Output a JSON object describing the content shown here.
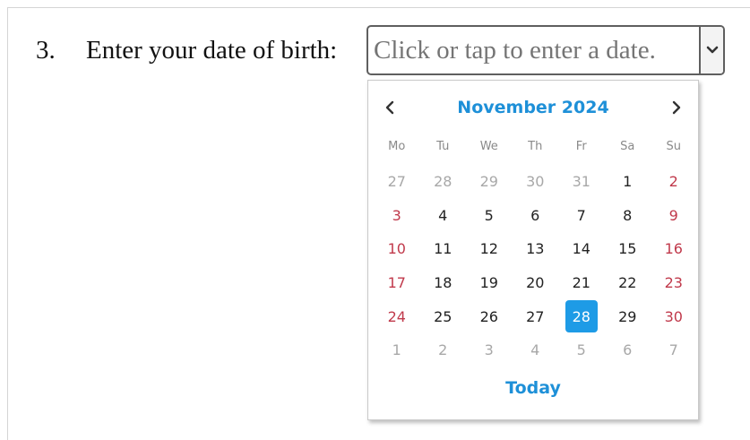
{
  "question": {
    "number": "3.",
    "text": "Enter your date of birth:"
  },
  "date_field": {
    "placeholder": "Click or tap to enter a date.",
    "dropdown_icon": "chevron-down-icon"
  },
  "calendar": {
    "month_label": "November 2024",
    "prev_icon": "chevron-left-icon",
    "next_icon": "chevron-right-icon",
    "weekdays": [
      "Mo",
      "Tu",
      "We",
      "Th",
      "Fr",
      "Sa",
      "Su"
    ],
    "weeks": [
      [
        {
          "d": "27",
          "out": true
        },
        {
          "d": "28",
          "out": true
        },
        {
          "d": "29",
          "out": true
        },
        {
          "d": "30",
          "out": true
        },
        {
          "d": "31",
          "out": true
        },
        {
          "d": "1"
        },
        {
          "d": "2",
          "wkend": true
        }
      ],
      [
        {
          "d": "3",
          "wkend": true
        },
        {
          "d": "4"
        },
        {
          "d": "5"
        },
        {
          "d": "6"
        },
        {
          "d": "7"
        },
        {
          "d": "8"
        },
        {
          "d": "9",
          "wkend": true
        }
      ],
      [
        {
          "d": "10",
          "wkend": true
        },
        {
          "d": "11"
        },
        {
          "d": "12"
        },
        {
          "d": "13"
        },
        {
          "d": "14"
        },
        {
          "d": "15"
        },
        {
          "d": "16",
          "wkend": true
        }
      ],
      [
        {
          "d": "17",
          "wkend": true
        },
        {
          "d": "18"
        },
        {
          "d": "19"
        },
        {
          "d": "20"
        },
        {
          "d": "21"
        },
        {
          "d": "22"
        },
        {
          "d": "23",
          "wkend": true
        }
      ],
      [
        {
          "d": "24",
          "wkend": true
        },
        {
          "d": "25"
        },
        {
          "d": "26"
        },
        {
          "d": "27"
        },
        {
          "d": "28",
          "selected": true
        },
        {
          "d": "29"
        },
        {
          "d": "30",
          "wkend": true
        }
      ],
      [
        {
          "d": "1",
          "out": true
        },
        {
          "d": "2",
          "out": true
        },
        {
          "d": "3",
          "out": true
        },
        {
          "d": "4",
          "out": true
        },
        {
          "d": "5",
          "out": true
        },
        {
          "d": "6",
          "out": true
        },
        {
          "d": "7",
          "out": true
        }
      ]
    ],
    "today_label": "Today",
    "colors": {
      "accent": "#1e90d8",
      "selected_bg": "#1e9be6",
      "weekend": "#c0394b",
      "muted": "#a8a8a8"
    }
  }
}
